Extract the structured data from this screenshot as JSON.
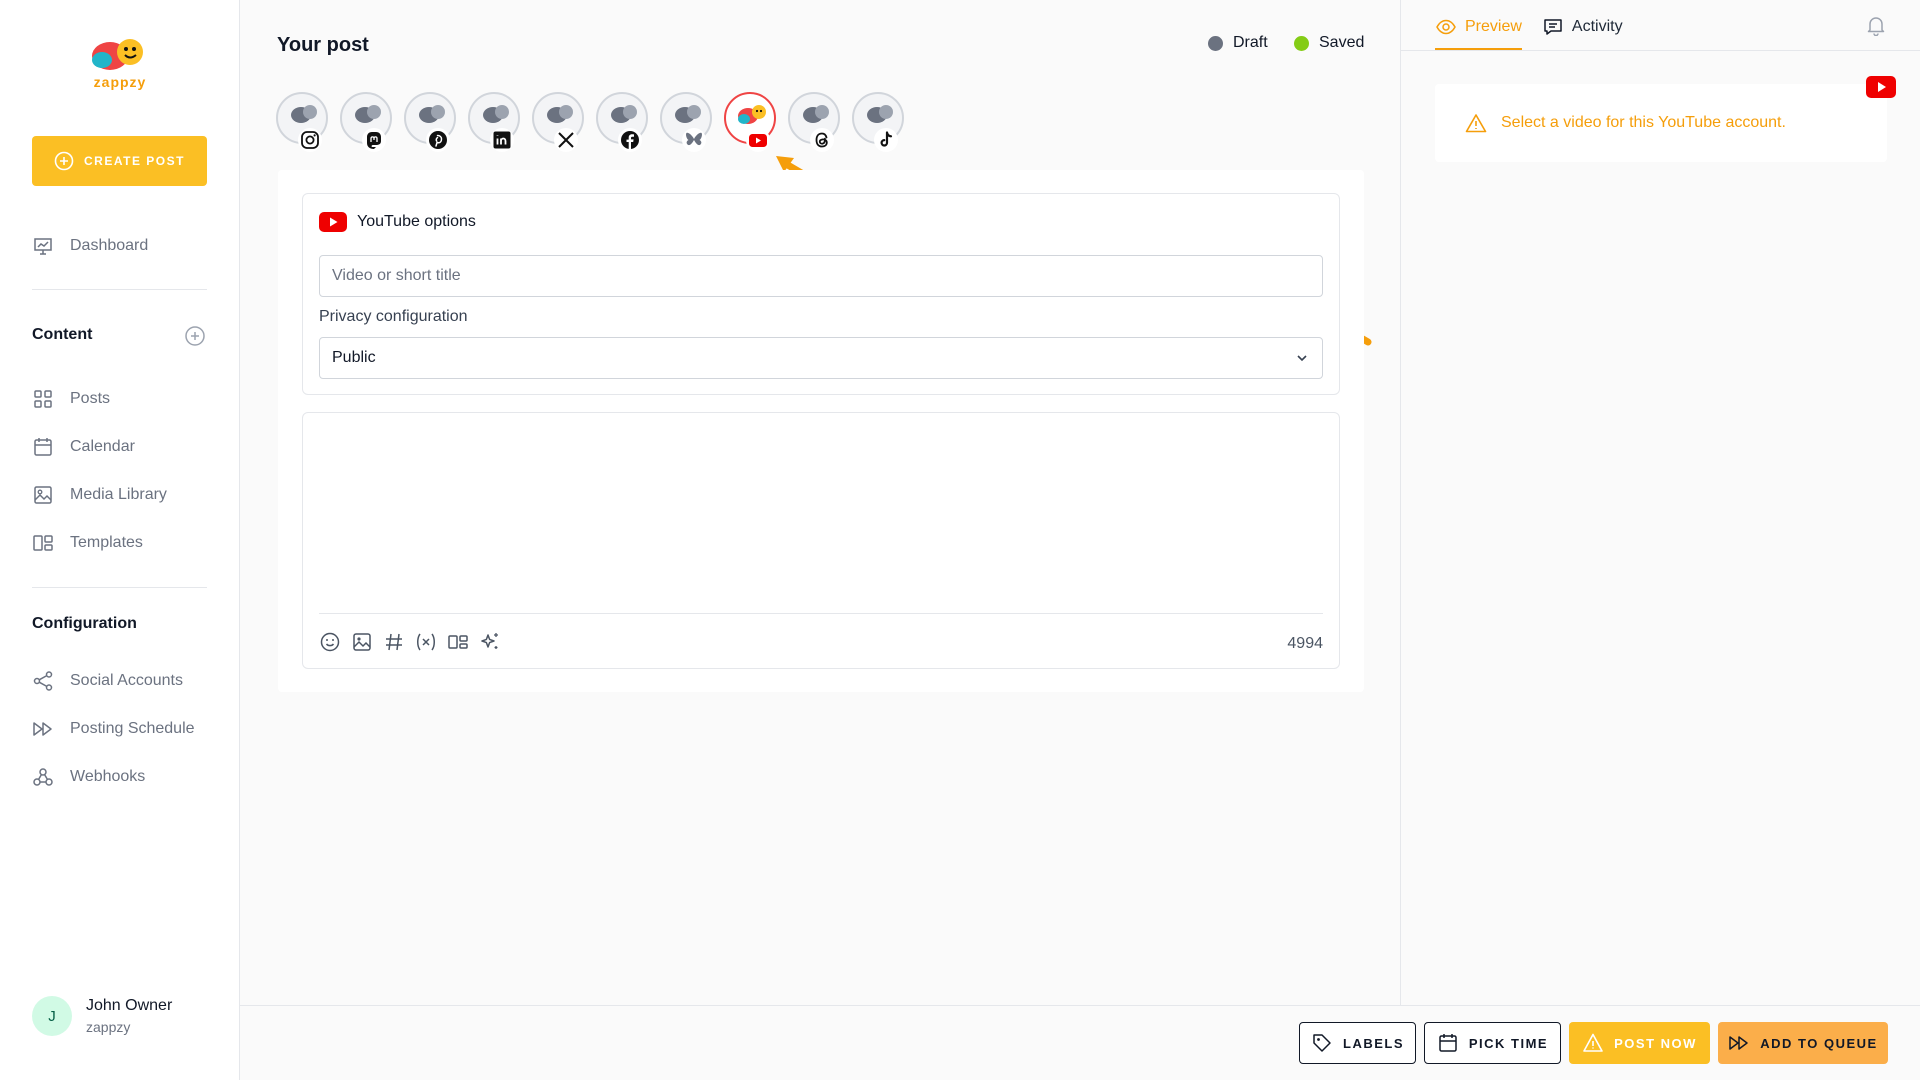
{
  "brand": {
    "logo_text": "zappzy"
  },
  "sidebar": {
    "create_post_label": "CREATE POST",
    "dashboard_label": "Dashboard",
    "content_title": "Content",
    "content_items": [
      {
        "label": "Posts",
        "icon": "grid-icon"
      },
      {
        "label": "Calendar",
        "icon": "calendar-icon"
      },
      {
        "label": "Media Library",
        "icon": "image-icon"
      },
      {
        "label": "Templates",
        "icon": "templates-icon"
      }
    ],
    "configuration_title": "Configuration",
    "configuration_items": [
      {
        "label": "Social Accounts",
        "icon": "share-icon"
      },
      {
        "label": "Posting Schedule",
        "icon": "fast-forward-icon"
      },
      {
        "label": "Webhooks",
        "icon": "webhook-icon"
      }
    ],
    "user": {
      "initial": "J",
      "name": "John Owner",
      "org": "zappzy"
    }
  },
  "main": {
    "title": "Your post",
    "status": {
      "draft_label": "Draft",
      "saved_label": "Saved"
    },
    "accounts": [
      {
        "network": "instagram",
        "active": false
      },
      {
        "network": "mastodon",
        "active": false
      },
      {
        "network": "pinterest",
        "active": false
      },
      {
        "network": "linkedin",
        "active": false
      },
      {
        "network": "x",
        "active": false
      },
      {
        "network": "facebook",
        "active": false
      },
      {
        "network": "bluesky",
        "active": false
      },
      {
        "network": "youtube",
        "active": true
      },
      {
        "network": "threads",
        "active": false
      },
      {
        "network": "tiktok",
        "active": false
      }
    ],
    "youtube_options": {
      "header": "YouTube options",
      "title_placeholder": "Video or short title",
      "privacy_label": "Privacy configuration",
      "privacy_value": "Public"
    },
    "editor": {
      "char_count": "4994"
    }
  },
  "right_panel": {
    "tabs": {
      "preview": "Preview",
      "activity": "Activity"
    },
    "warning": "Select a video for this YouTube account."
  },
  "actions": {
    "labels": "LABELS",
    "pick_time": "PICK TIME",
    "post_now": "POST NOW",
    "add_to_queue": "ADD TO QUEUE"
  },
  "colors": {
    "accent": "#fbbf24",
    "draft_dot": "#6b7280",
    "saved_dot": "#84cc16",
    "warning": "#f59e0b",
    "youtube": "#ef0000"
  }
}
